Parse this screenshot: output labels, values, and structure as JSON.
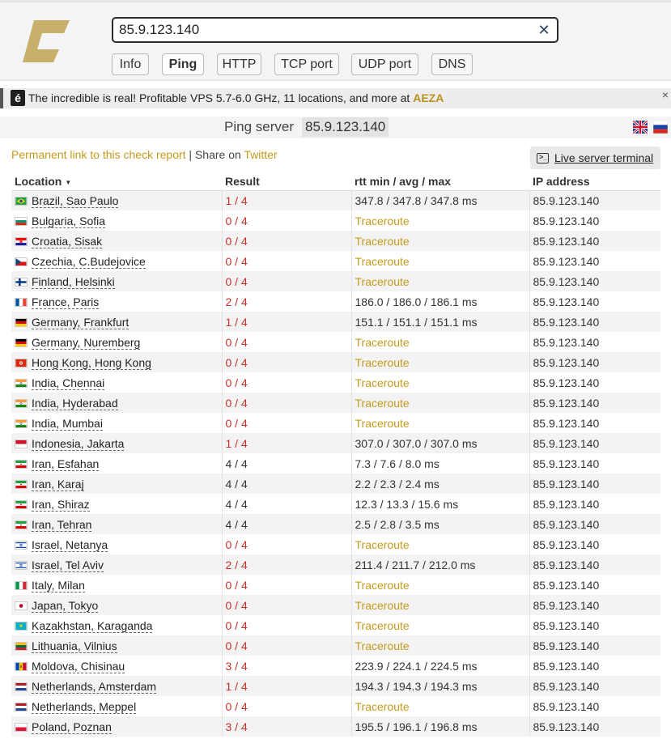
{
  "search": {
    "value": "85.9.123.140",
    "clear_symbol": "✕"
  },
  "tabs": [
    {
      "label": "Info",
      "active": false
    },
    {
      "label": "Ping",
      "active": true
    },
    {
      "label": "HTTP",
      "active": false
    },
    {
      "label": "TCP port",
      "active": false
    },
    {
      "label": "UDP port",
      "active": false
    },
    {
      "label": "DNS",
      "active": false
    }
  ],
  "promo": {
    "icon_letter": "é",
    "text": "The incredible is real! Profitable VPS 5.7-6.0 GHz, 11 locations, and more at ",
    "brand": "AEZA",
    "close_symbol": "×"
  },
  "server": {
    "label": "Ping server",
    "host": "85.9.123.140"
  },
  "report": {
    "permalink": "Permanent link to this check report",
    "separator": " | Share on ",
    "twitter": "Twitter",
    "terminal_button": "Live server terminal"
  },
  "table": {
    "headers": {
      "location": "Location",
      "result": "Result",
      "rtt": "rtt min / avg / max",
      "ip": "IP address"
    },
    "rows": [
      {
        "flag": "br",
        "location": "Brazil, Sao Paulo",
        "result": "1 / 4",
        "status": "partial",
        "rtt": "347.8 / 347.8 / 347.8 ms",
        "ip": "85.9.123.140"
      },
      {
        "flag": "bg",
        "location": "Bulgaria, Sofia",
        "result": "0 / 4",
        "status": "fail",
        "rtt": "Traceroute",
        "ip": "85.9.123.140"
      },
      {
        "flag": "hr",
        "location": "Croatia, Sisak",
        "result": "0 / 4",
        "status": "fail",
        "rtt": "Traceroute",
        "ip": "85.9.123.140"
      },
      {
        "flag": "cz",
        "location": "Czechia, C.Budejovice",
        "result": "0 / 4",
        "status": "fail",
        "rtt": "Traceroute",
        "ip": "85.9.123.140"
      },
      {
        "flag": "fi",
        "location": "Finland, Helsinki",
        "result": "0 / 4",
        "status": "fail",
        "rtt": "Traceroute",
        "ip": "85.9.123.140"
      },
      {
        "flag": "fr",
        "location": "France, Paris",
        "result": "2 / 4",
        "status": "partial",
        "rtt": "186.0 / 186.0 / 186.1 ms",
        "ip": "85.9.123.140"
      },
      {
        "flag": "de",
        "location": "Germany, Frankfurt",
        "result": "1 / 4",
        "status": "partial",
        "rtt": "151.1 / 151.1 / 151.1 ms",
        "ip": "85.9.123.140"
      },
      {
        "flag": "de",
        "location": "Germany, Nuremberg",
        "result": "0 / 4",
        "status": "fail",
        "rtt": "Traceroute",
        "ip": "85.9.123.140"
      },
      {
        "flag": "hk",
        "location": "Hong Kong, Hong Kong",
        "result": "0 / 4",
        "status": "fail",
        "rtt": "Traceroute",
        "ip": "85.9.123.140"
      },
      {
        "flag": "in",
        "location": "India, Chennai",
        "result": "0 / 4",
        "status": "fail",
        "rtt": "Traceroute",
        "ip": "85.9.123.140"
      },
      {
        "flag": "in",
        "location": "India, Hyderabad",
        "result": "0 / 4",
        "status": "fail",
        "rtt": "Traceroute",
        "ip": "85.9.123.140"
      },
      {
        "flag": "in",
        "location": "India, Mumbai",
        "result": "0 / 4",
        "status": "fail",
        "rtt": "Traceroute",
        "ip": "85.9.123.140"
      },
      {
        "flag": "id",
        "location": "Indonesia, Jakarta",
        "result": "1 / 4",
        "status": "partial",
        "rtt": "307.0 / 307.0 / 307.0 ms",
        "ip": "85.9.123.140"
      },
      {
        "flag": "ir",
        "location": "Iran, Esfahan",
        "result": "4 / 4",
        "status": "ok",
        "rtt": "7.3 / 7.6 / 8.0 ms",
        "ip": "85.9.123.140"
      },
      {
        "flag": "ir",
        "location": "Iran, Karaj",
        "result": "4 / 4",
        "status": "ok",
        "rtt": "2.2 / 2.3 / 2.4 ms",
        "ip": "85.9.123.140"
      },
      {
        "flag": "ir",
        "location": "Iran, Shiraz",
        "result": "4 / 4",
        "status": "ok",
        "rtt": "12.3 / 13.3 / 15.6 ms",
        "ip": "85.9.123.140"
      },
      {
        "flag": "ir",
        "location": "Iran, Tehran",
        "result": "4 / 4",
        "status": "ok",
        "rtt": "2.5 / 2.8 / 3.5 ms",
        "ip": "85.9.123.140"
      },
      {
        "flag": "il",
        "location": "Israel, Netanya",
        "result": "0 / 4",
        "status": "fail",
        "rtt": "Traceroute",
        "ip": "85.9.123.140"
      },
      {
        "flag": "il",
        "location": "Israel, Tel Aviv",
        "result": "2 / 4",
        "status": "partial",
        "rtt": "211.4 / 211.7 / 212.0 ms",
        "ip": "85.9.123.140"
      },
      {
        "flag": "it",
        "location": "Italy, Milan",
        "result": "0 / 4",
        "status": "fail",
        "rtt": "Traceroute",
        "ip": "85.9.123.140"
      },
      {
        "flag": "jp",
        "location": "Japan, Tokyo",
        "result": "0 / 4",
        "status": "fail",
        "rtt": "Traceroute",
        "ip": "85.9.123.140"
      },
      {
        "flag": "kz",
        "location": "Kazakhstan, Karaganda",
        "result": "0 / 4",
        "status": "fail",
        "rtt": "Traceroute",
        "ip": "85.9.123.140"
      },
      {
        "flag": "lt",
        "location": "Lithuania, Vilnius",
        "result": "0 / 4",
        "status": "fail",
        "rtt": "Traceroute",
        "ip": "85.9.123.140"
      },
      {
        "flag": "md",
        "location": "Moldova, Chisinau",
        "result": "3 / 4",
        "status": "partial",
        "rtt": "223.9 / 224.1 / 224.5 ms",
        "ip": "85.9.123.140"
      },
      {
        "flag": "nl",
        "location": "Netherlands, Amsterdam",
        "result": "1 / 4",
        "status": "partial",
        "rtt": "194.3 / 194.3 / 194.3 ms",
        "ip": "85.9.123.140"
      },
      {
        "flag": "nl",
        "location": "Netherlands, Meppel",
        "result": "0 / 4",
        "status": "fail",
        "rtt": "Traceroute",
        "ip": "85.9.123.140"
      },
      {
        "flag": "pl",
        "location": "Poland, Poznan",
        "result": "3 / 4",
        "status": "partial",
        "rtt": "195.5 / 196.1 / 196.8 ms",
        "ip": "85.9.123.140"
      }
    ]
  },
  "colors": {
    "brand_gold": "#c9b06a",
    "link_gold": "#c49a1c",
    "fail_red": "#c8302a",
    "row_stripe": "#f3f3f3"
  },
  "icons": {
    "logo": "check-host-logo",
    "clear": "close-icon",
    "promo": "aeza-e-icon",
    "terminal": "terminal-icon",
    "sort": "sort-down-icon",
    "lang_en": "uk-flag-icon",
    "lang_ru": "ru-flag-icon"
  }
}
